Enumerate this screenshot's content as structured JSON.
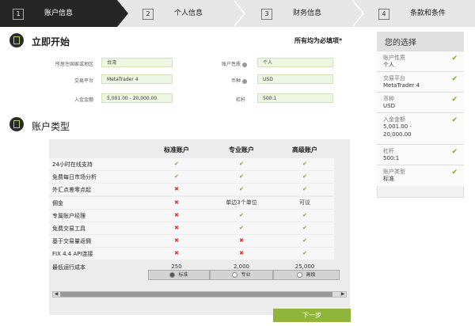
{
  "steps": [
    {
      "num": "1",
      "label": "账户信息"
    },
    {
      "num": "2",
      "label": "个人信息"
    },
    {
      "num": "3",
      "label": "财务信息"
    },
    {
      "num": "4",
      "label": "条款和条件"
    }
  ],
  "start": {
    "title": "立即开始",
    "required_note": "所有均为必填项*",
    "fields": {
      "country": {
        "label": "所居住国家或地区",
        "value": "台湾"
      },
      "platform": {
        "label": "交易平台",
        "value": "MetaTrader 4"
      },
      "deposit": {
        "label": "入金金额",
        "value": "5,001.00 - 20,000.00"
      },
      "acct_type": {
        "label": "账户性质",
        "value": "个人"
      },
      "currency": {
        "label": "币种",
        "value": "USD"
      },
      "leverage": {
        "label": "杠杆",
        "value": "500:1"
      }
    }
  },
  "account_types": {
    "title": "账户类型",
    "columns": [
      "标准账户",
      "专业账户",
      "高级账户"
    ],
    "rows": [
      {
        "label": "24小时在线支持",
        "cells": [
          "ok",
          "ok",
          "ok"
        ]
      },
      {
        "label": "免费每日市场分析",
        "cells": [
          "ok",
          "ok",
          "ok"
        ]
      },
      {
        "label": "外汇点差零点起",
        "cells": [
          "no",
          "ok",
          "ok"
        ]
      },
      {
        "label": "佣金",
        "cells": [
          "no",
          "单边3个单位",
          "可议"
        ]
      },
      {
        "label": "专属账户经理",
        "cells": [
          "no",
          "ok",
          "ok"
        ]
      },
      {
        "label": "免费交易工具",
        "cells": [
          "no",
          "ok",
          "ok"
        ]
      },
      {
        "label": "基于交易量返佣",
        "cells": [
          "no",
          "no",
          "ok"
        ]
      },
      {
        "label": "FIX 4.4 API连接",
        "cells": [
          "no",
          "no",
          "ok"
        ]
      },
      {
        "label": "最低运行成本",
        "cells": [
          "250",
          "2,000",
          "25,000"
        ]
      }
    ],
    "radios": [
      {
        "label": "标准",
        "selected": true
      },
      {
        "label": "专业",
        "selected": false
      },
      {
        "label": "高级",
        "selected": false
      }
    ]
  },
  "next_button": "下一步",
  "summary": {
    "title": "您的选择",
    "items": [
      {
        "key": "账户性质",
        "value": "个人",
        "value2": ""
      },
      {
        "key": "交易平台",
        "value": "MetaTrader 4",
        "value2": ""
      },
      {
        "key": "币种",
        "value": "USD",
        "value2": ""
      },
      {
        "key": "入金金额",
        "value": "5,001.00 -",
        "value2": "20,000.00"
      },
      {
        "key": "杠杆",
        "value": "500:1",
        "value2": ""
      },
      {
        "key": "账户类型",
        "value": "标准",
        "value2": ""
      }
    ]
  },
  "glyphs": {
    "check": "✔",
    "cross": "✖"
  },
  "colors": {
    "accent": "#8fb63a",
    "check": "#7aaa2a",
    "cross": "#d8342f",
    "active_step": "#262626"
  }
}
